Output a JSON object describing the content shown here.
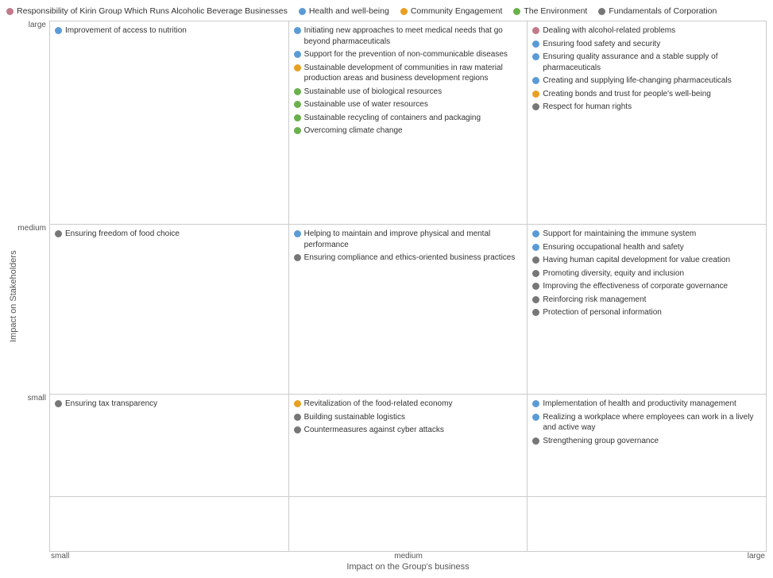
{
  "legend": {
    "items": [
      {
        "id": "alcohol",
        "label": "Responsibility of Kirin Group Which Runs Alcoholic Beverage Businesses",
        "color": "#c07a8a"
      },
      {
        "id": "health",
        "label": "Health and well-being",
        "color": "#5b9bd5"
      },
      {
        "id": "community",
        "label": "Community Engagement",
        "color": "#e8a020"
      },
      {
        "id": "environment",
        "label": "The Environment",
        "color": "#6ab04c"
      },
      {
        "id": "fundamentals",
        "label": "Fundamentals of Corporation",
        "color": "#777"
      }
    ]
  },
  "y_axis": {
    "main_label": "Impact on Stakeholders",
    "ticks": [
      "large",
      "medium",
      "small"
    ]
  },
  "x_axis": {
    "main_label": "Impact on the Group's business",
    "ticks": [
      "small",
      "medium",
      "large"
    ]
  },
  "cells": {
    "row0": {
      "col0": [
        {
          "color": "#5b9bd5",
          "text": "Improvement of access to nutrition"
        }
      ],
      "col1": [
        {
          "color": "#5b9bd5",
          "text": "Initiating new approaches to meet medical needs that go beyond pharmaceuticals"
        },
        {
          "color": "#5b9bd5",
          "text": "Support for the prevention of non-communicable diseases"
        },
        {
          "color": "#e8a020",
          "text": "Sustainable development of communities in raw material production areas and business development regions"
        },
        {
          "color": "#6ab04c",
          "text": "Sustainable use of biological resources"
        },
        {
          "color": "#6ab04c",
          "text": "Sustainable use of water resources"
        },
        {
          "color": "#6ab04c",
          "text": "Sustainable recycling of containers and packaging"
        },
        {
          "color": "#6ab04c",
          "text": "Overcoming climate change"
        }
      ],
      "col2": [
        {
          "color": "#c07a8a",
          "text": "Dealing with alcohol-related problems"
        },
        {
          "color": "#5b9bd5",
          "text": "Ensuring food safety and security"
        },
        {
          "color": "#5b9bd5",
          "text": "Ensuring quality assurance and a stable supply of pharmaceuticals"
        },
        {
          "color": "#5b9bd5",
          "text": "Creating and supplying life-changing pharmaceuticals"
        },
        {
          "color": "#e8a020",
          "text": "Creating bonds and trust for people's well-being"
        },
        {
          "color": "#777",
          "text": "Respect for human rights"
        }
      ]
    },
    "row1": {
      "col0": [
        {
          "color": "#777",
          "text": "Ensuring freedom of food choice"
        }
      ],
      "col1": [
        {
          "color": "#5b9bd5",
          "text": "Helping to maintain and improve physical and mental performance"
        },
        {
          "color": "#777",
          "text": "Ensuring compliance and ethics-oriented business practices"
        }
      ],
      "col2": [
        {
          "color": "#5b9bd5",
          "text": "Support for maintaining the immune system"
        },
        {
          "color": "#5b9bd5",
          "text": "Ensuring occupational health and safety"
        },
        {
          "color": "#777",
          "text": "Having human capital development for value creation"
        },
        {
          "color": "#777",
          "text": "Promoting diversity, equity and inclusion"
        },
        {
          "color": "#777",
          "text": "Improving the effectiveness of corporate governance"
        },
        {
          "color": "#777",
          "text": "Reinforcing risk management"
        },
        {
          "color": "#777",
          "text": "Protection of personal information"
        }
      ]
    },
    "row2": {
      "col0": [
        {
          "color": "#777",
          "text": "Ensuring tax transparency"
        }
      ],
      "col1": [
        {
          "color": "#e8a020",
          "text": "Revitalization of the food-related economy"
        },
        {
          "color": "#777",
          "text": "Building sustainable logistics"
        },
        {
          "color": "#777",
          "text": "Countermeasures against cyber attacks"
        }
      ],
      "col2": [
        {
          "color": "#5b9bd5",
          "text": "Implementation of health and productivity management"
        },
        {
          "color": "#5b9bd5",
          "text": "Realizing a workplace where employees can work in a lively and active way"
        },
        {
          "color": "#777",
          "text": "Strengthening group governance"
        }
      ]
    },
    "row3": {
      "col0": [],
      "col1": [],
      "col2": []
    }
  }
}
